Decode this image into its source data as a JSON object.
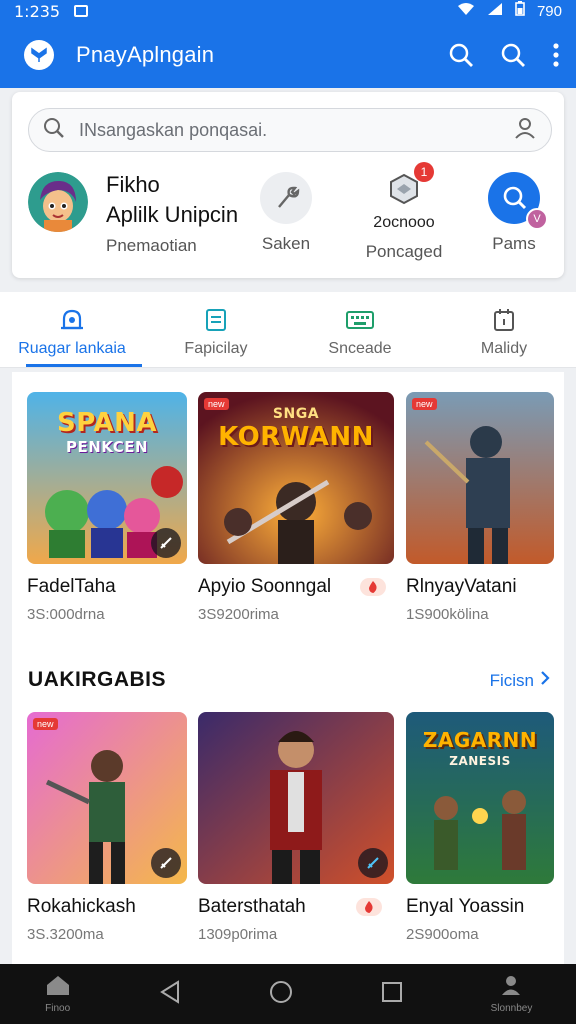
{
  "status_bar": {
    "time": "1:235",
    "battery": "790"
  },
  "app_bar": {
    "title": "PnayAplngain",
    "icons": [
      "logo-icon",
      "search-icon",
      "search-icon",
      "more-vert-icon"
    ]
  },
  "search": {
    "placeholder": "INsangaskan ponqasai."
  },
  "profile": {
    "name": "Fikho",
    "subtitle": "Aplilk Unipcin",
    "caption": "Pnemaotian"
  },
  "stats": [
    {
      "label": "Saken",
      "icon": "wrench-icon"
    },
    {
      "count": "2ocnooo",
      "label": "Poncaged",
      "badge": "1",
      "icon": "package-icon"
    },
    {
      "label": "Pams",
      "badge": "V",
      "icon": "chat-search-icon"
    }
  ],
  "tabs": [
    {
      "label": "Ruagar lankaia",
      "icon": "alarm-icon",
      "active": true
    },
    {
      "label": "Fapicilay",
      "icon": "document-icon"
    },
    {
      "label": "Snceade",
      "icon": "keyboard-icon"
    },
    {
      "label": "Malidy",
      "icon": "calendar-icon"
    }
  ],
  "section1": {
    "games": [
      {
        "title": "FadelTaha",
        "meta": "3S:000drna",
        "art_text_1": "SPANA",
        "art_text_2": "PENKCEN"
      },
      {
        "title": "Apyio Soonngal",
        "meta": "3S9200rima",
        "tag": "new",
        "art_text_1": "SNGA",
        "art_text_2": "KORWANN"
      },
      {
        "title": "RlnyayVatani",
        "meta": "1S900kölina",
        "tag": "new"
      }
    ]
  },
  "section2": {
    "heading": "UAKIRGABIS",
    "link": "Ficisn",
    "games": [
      {
        "title": "Rokahickash",
        "meta": "3S.3200ma",
        "tag": "new"
      },
      {
        "title": "Batersthatah",
        "meta": "1309p0rima"
      },
      {
        "title": "Enyal Yoassin",
        "meta": "2S900oma",
        "art_text_1": "ZAGARNN",
        "art_text_2": "ZANESIS"
      }
    ]
  },
  "nav": {
    "home_label": "Finoo",
    "profile_label": "Slonnbey"
  },
  "colors": {
    "primary": "#1a73e8",
    "danger": "#e53935",
    "nav_bg": "#111111"
  }
}
